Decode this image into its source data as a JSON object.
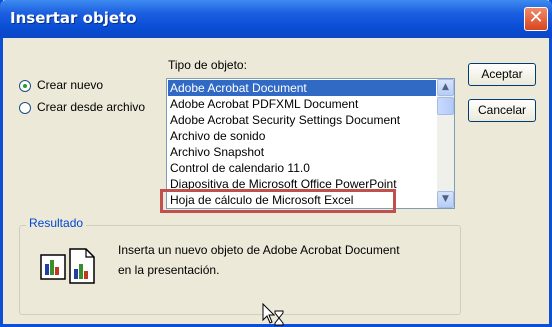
{
  "window": {
    "title": "Insertar objeto",
    "close_glyph": "✕"
  },
  "options": {
    "create_new": {
      "label": "Crear nuevo",
      "selected": true
    },
    "create_from_file": {
      "label": "Crear desde archivo",
      "selected": false
    }
  },
  "object_type": {
    "label": "Tipo de objeto:",
    "items": [
      {
        "label": "Adobe Acrobat Document",
        "selected": true
      },
      {
        "label": "Adobe Acrobat PDFXML Document",
        "selected": false
      },
      {
        "label": "Adobe Acrobat Security Settings Document",
        "selected": false
      },
      {
        "label": "Archivo de sonido",
        "selected": false
      },
      {
        "label": "Archivo Snapshot",
        "selected": false
      },
      {
        "label": "Control de calendario 11.0",
        "selected": false
      },
      {
        "label": "Diapositiva de Microsoft Office PowerPoint",
        "selected": false
      },
      {
        "label": "Hoja de cálculo de Microsoft Excel",
        "selected": false
      }
    ]
  },
  "buttons": {
    "accept": "Aceptar",
    "cancel": "Cancelar"
  },
  "result": {
    "label": "Resultado",
    "line1": "Inserta un nuevo objeto de Adobe Acrobat Document",
    "line2": "en la presentación."
  },
  "colors": {
    "highlight_box": "#c0504d",
    "title_bar": "#0a4fd6",
    "selection": "#316ac5"
  },
  "icons": {
    "close": "close-icon",
    "scroll_up": "scroll-up-icon",
    "scroll_down": "scroll-down-icon",
    "result": "embedded-chart-icon",
    "cursor": "hourglass-cursor-icon"
  }
}
